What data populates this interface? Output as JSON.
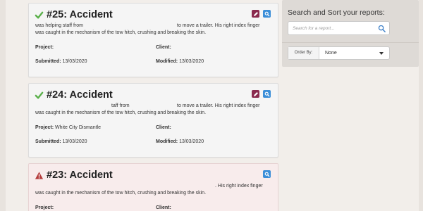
{
  "reports": [
    {
      "title": "#25: Accident",
      "status": "completed",
      "status_icon": "checkmark-icon",
      "status_color": "#5ab04a",
      "actions": [
        "edit-icon",
        "view-icon"
      ],
      "desc_part1": "was helping staff from",
      "desc_part2": "to move a trailer. His right index finger",
      "desc_line2": "was caught in the mechanism of the tow hitch, crushing and breaking the skin.",
      "project_label": "Project:",
      "project_value": "",
      "client_label": "Client:",
      "client_value": "",
      "submitted_label": "Submitted:",
      "submitted_value": "13/03/2020",
      "modified_label": "Modified:",
      "modified_value": "13/03/2020"
    },
    {
      "title": "#24: Accident",
      "status": "completed",
      "status_icon": "checkmark-icon",
      "status_color": "#5ab04a",
      "actions": [
        "edit-icon",
        "view-icon"
      ],
      "desc_part1": "taff from",
      "desc_part2": "to move a trailer. His right index finger",
      "desc_line2": "was caught in the mechanism of the tow hitch, crushing and breaking the skin.",
      "project_label": "Project:",
      "project_value": "White City Dismantle",
      "client_label": "Client:",
      "client_value": "",
      "submitted_label": "Submitted:",
      "submitted_value": "13/03/2020",
      "modified_label": "Modified:",
      "modified_value": "13/03/2020"
    },
    {
      "title": "#23: Accident",
      "status": "warning",
      "status_icon": "warning-icon",
      "status_color": "#b33a3a",
      "actions": [
        "view-icon"
      ],
      "desc_part1": "",
      "desc_part2": ". His right index finger",
      "desc_line2": "was caught in the mechanism of the tow hitch, crushing and breaking the skin.",
      "project_label": "Project:",
      "project_value": "",
      "client_label": "Client:",
      "client_value": ""
    }
  ],
  "sidebar": {
    "title": "Search and Sort your reports:",
    "search_placeholder": "Search for a report...",
    "search_icon": "search-icon",
    "order_label": "Order By:",
    "order_value": "None",
    "order_icon": "caret-down-icon"
  },
  "colors": {
    "background": "#f2eeea",
    "card": "#f5f5f5",
    "warning_card": "#f8ecec",
    "edit_action": "#8a2a4e",
    "view_action": "#3b8ed8",
    "accent_blue": "#3b7fc8"
  }
}
